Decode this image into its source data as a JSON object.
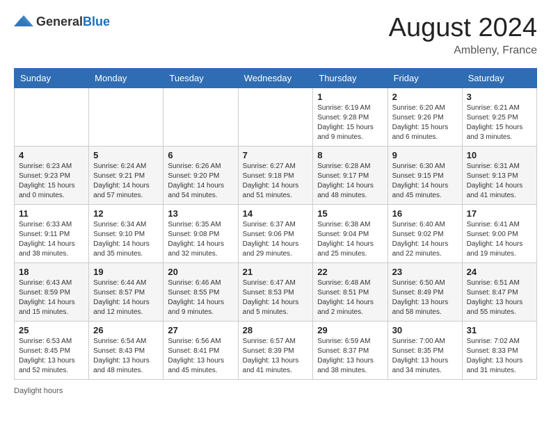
{
  "header": {
    "logo_general": "General",
    "logo_blue": "Blue",
    "month_year": "August 2024",
    "location": "Ambleny, France"
  },
  "footer": {
    "daylight_label": "Daylight hours"
  },
  "weekdays": [
    "Sunday",
    "Monday",
    "Tuesday",
    "Wednesday",
    "Thursday",
    "Friday",
    "Saturday"
  ],
  "weeks": [
    [
      {
        "day": "",
        "info": ""
      },
      {
        "day": "",
        "info": ""
      },
      {
        "day": "",
        "info": ""
      },
      {
        "day": "",
        "info": ""
      },
      {
        "day": "1",
        "info": "Sunrise: 6:19 AM\nSunset: 9:28 PM\nDaylight: 15 hours\nand 9 minutes."
      },
      {
        "day": "2",
        "info": "Sunrise: 6:20 AM\nSunset: 9:26 PM\nDaylight: 15 hours\nand 6 minutes."
      },
      {
        "day": "3",
        "info": "Sunrise: 6:21 AM\nSunset: 9:25 PM\nDaylight: 15 hours\nand 3 minutes."
      }
    ],
    [
      {
        "day": "4",
        "info": "Sunrise: 6:23 AM\nSunset: 9:23 PM\nDaylight: 15 hours\nand 0 minutes."
      },
      {
        "day": "5",
        "info": "Sunrise: 6:24 AM\nSunset: 9:21 PM\nDaylight: 14 hours\nand 57 minutes."
      },
      {
        "day": "6",
        "info": "Sunrise: 6:26 AM\nSunset: 9:20 PM\nDaylight: 14 hours\nand 54 minutes."
      },
      {
        "day": "7",
        "info": "Sunrise: 6:27 AM\nSunset: 9:18 PM\nDaylight: 14 hours\nand 51 minutes."
      },
      {
        "day": "8",
        "info": "Sunrise: 6:28 AM\nSunset: 9:17 PM\nDaylight: 14 hours\nand 48 minutes."
      },
      {
        "day": "9",
        "info": "Sunrise: 6:30 AM\nSunset: 9:15 PM\nDaylight: 14 hours\nand 45 minutes."
      },
      {
        "day": "10",
        "info": "Sunrise: 6:31 AM\nSunset: 9:13 PM\nDaylight: 14 hours\nand 41 minutes."
      }
    ],
    [
      {
        "day": "11",
        "info": "Sunrise: 6:33 AM\nSunset: 9:11 PM\nDaylight: 14 hours\nand 38 minutes."
      },
      {
        "day": "12",
        "info": "Sunrise: 6:34 AM\nSunset: 9:10 PM\nDaylight: 14 hours\nand 35 minutes."
      },
      {
        "day": "13",
        "info": "Sunrise: 6:35 AM\nSunset: 9:08 PM\nDaylight: 14 hours\nand 32 minutes."
      },
      {
        "day": "14",
        "info": "Sunrise: 6:37 AM\nSunset: 9:06 PM\nDaylight: 14 hours\nand 29 minutes."
      },
      {
        "day": "15",
        "info": "Sunrise: 6:38 AM\nSunset: 9:04 PM\nDaylight: 14 hours\nand 25 minutes."
      },
      {
        "day": "16",
        "info": "Sunrise: 6:40 AM\nSunset: 9:02 PM\nDaylight: 14 hours\nand 22 minutes."
      },
      {
        "day": "17",
        "info": "Sunrise: 6:41 AM\nSunset: 9:00 PM\nDaylight: 14 hours\nand 19 minutes."
      }
    ],
    [
      {
        "day": "18",
        "info": "Sunrise: 6:43 AM\nSunset: 8:59 PM\nDaylight: 14 hours\nand 15 minutes."
      },
      {
        "day": "19",
        "info": "Sunrise: 6:44 AM\nSunset: 8:57 PM\nDaylight: 14 hours\nand 12 minutes."
      },
      {
        "day": "20",
        "info": "Sunrise: 6:46 AM\nSunset: 8:55 PM\nDaylight: 14 hours\nand 9 minutes."
      },
      {
        "day": "21",
        "info": "Sunrise: 6:47 AM\nSunset: 8:53 PM\nDaylight: 14 hours\nand 5 minutes."
      },
      {
        "day": "22",
        "info": "Sunrise: 6:48 AM\nSunset: 8:51 PM\nDaylight: 14 hours\nand 2 minutes."
      },
      {
        "day": "23",
        "info": "Sunrise: 6:50 AM\nSunset: 8:49 PM\nDaylight: 13 hours\nand 58 minutes."
      },
      {
        "day": "24",
        "info": "Sunrise: 6:51 AM\nSunset: 8:47 PM\nDaylight: 13 hours\nand 55 minutes."
      }
    ],
    [
      {
        "day": "25",
        "info": "Sunrise: 6:53 AM\nSunset: 8:45 PM\nDaylight: 13 hours\nand 52 minutes."
      },
      {
        "day": "26",
        "info": "Sunrise: 6:54 AM\nSunset: 8:43 PM\nDaylight: 13 hours\nand 48 minutes."
      },
      {
        "day": "27",
        "info": "Sunrise: 6:56 AM\nSunset: 8:41 PM\nDaylight: 13 hours\nand 45 minutes."
      },
      {
        "day": "28",
        "info": "Sunrise: 6:57 AM\nSunset: 8:39 PM\nDaylight: 13 hours\nand 41 minutes."
      },
      {
        "day": "29",
        "info": "Sunrise: 6:59 AM\nSunset: 8:37 PM\nDaylight: 13 hours\nand 38 minutes."
      },
      {
        "day": "30",
        "info": "Sunrise: 7:00 AM\nSunset: 8:35 PM\nDaylight: 13 hours\nand 34 minutes."
      },
      {
        "day": "31",
        "info": "Sunrise: 7:02 AM\nSunset: 8:33 PM\nDaylight: 13 hours\nand 31 minutes."
      }
    ]
  ]
}
